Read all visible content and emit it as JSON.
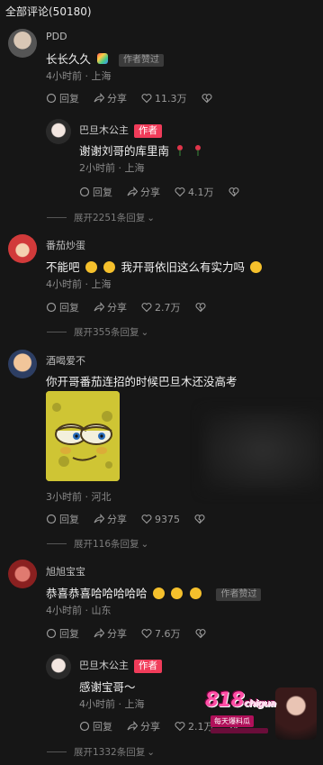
{
  "header": {
    "title": "全部评论(50180)"
  },
  "labels": {
    "author_tag": "作者",
    "author_liked": "作者赞过",
    "reply": "回复",
    "share": "分享"
  },
  "comments": [
    {
      "user": "PDD",
      "text": "长长久久",
      "time": "4小时前 · 上海",
      "likes": "11.3万",
      "reply": {
        "user": "巴旦木公主",
        "text": "谢谢刘哥的库里南",
        "time": "2小时前 · 上海",
        "likes": "4.1万"
      },
      "expand": "展开2251条回复"
    },
    {
      "user": "番茄炒蛋",
      "text1": "不能吧",
      "text2": "我开哥依旧这么有实力吗",
      "time": "4小时前 · 上海",
      "likes": "2.7万",
      "expand": "展开355条回复"
    },
    {
      "user": "酒喝爱不",
      "text": "你开哥番茄连招的时候巴旦木还没高考",
      "time": "3小时前 · 河北",
      "likes": "9375",
      "expand": "展开116条回复"
    },
    {
      "user": "旭旭宝宝",
      "text": "恭喜恭喜哈哈哈哈哈",
      "time": "4小时前 · 山东",
      "likes": "7.6万",
      "reply": {
        "user": "巴旦木公主",
        "text": "感谢宝哥～",
        "time": "4小时前 · 上海",
        "likes": "2.1万"
      },
      "expand": "展开1332条回复"
    }
  ],
  "watermark": {
    "brand": "818",
    "sub": "chigua",
    "slogan": "每天爆料瓜"
  },
  "colors": {
    "background": "#161616",
    "author_badge": "#f03c5a"
  }
}
